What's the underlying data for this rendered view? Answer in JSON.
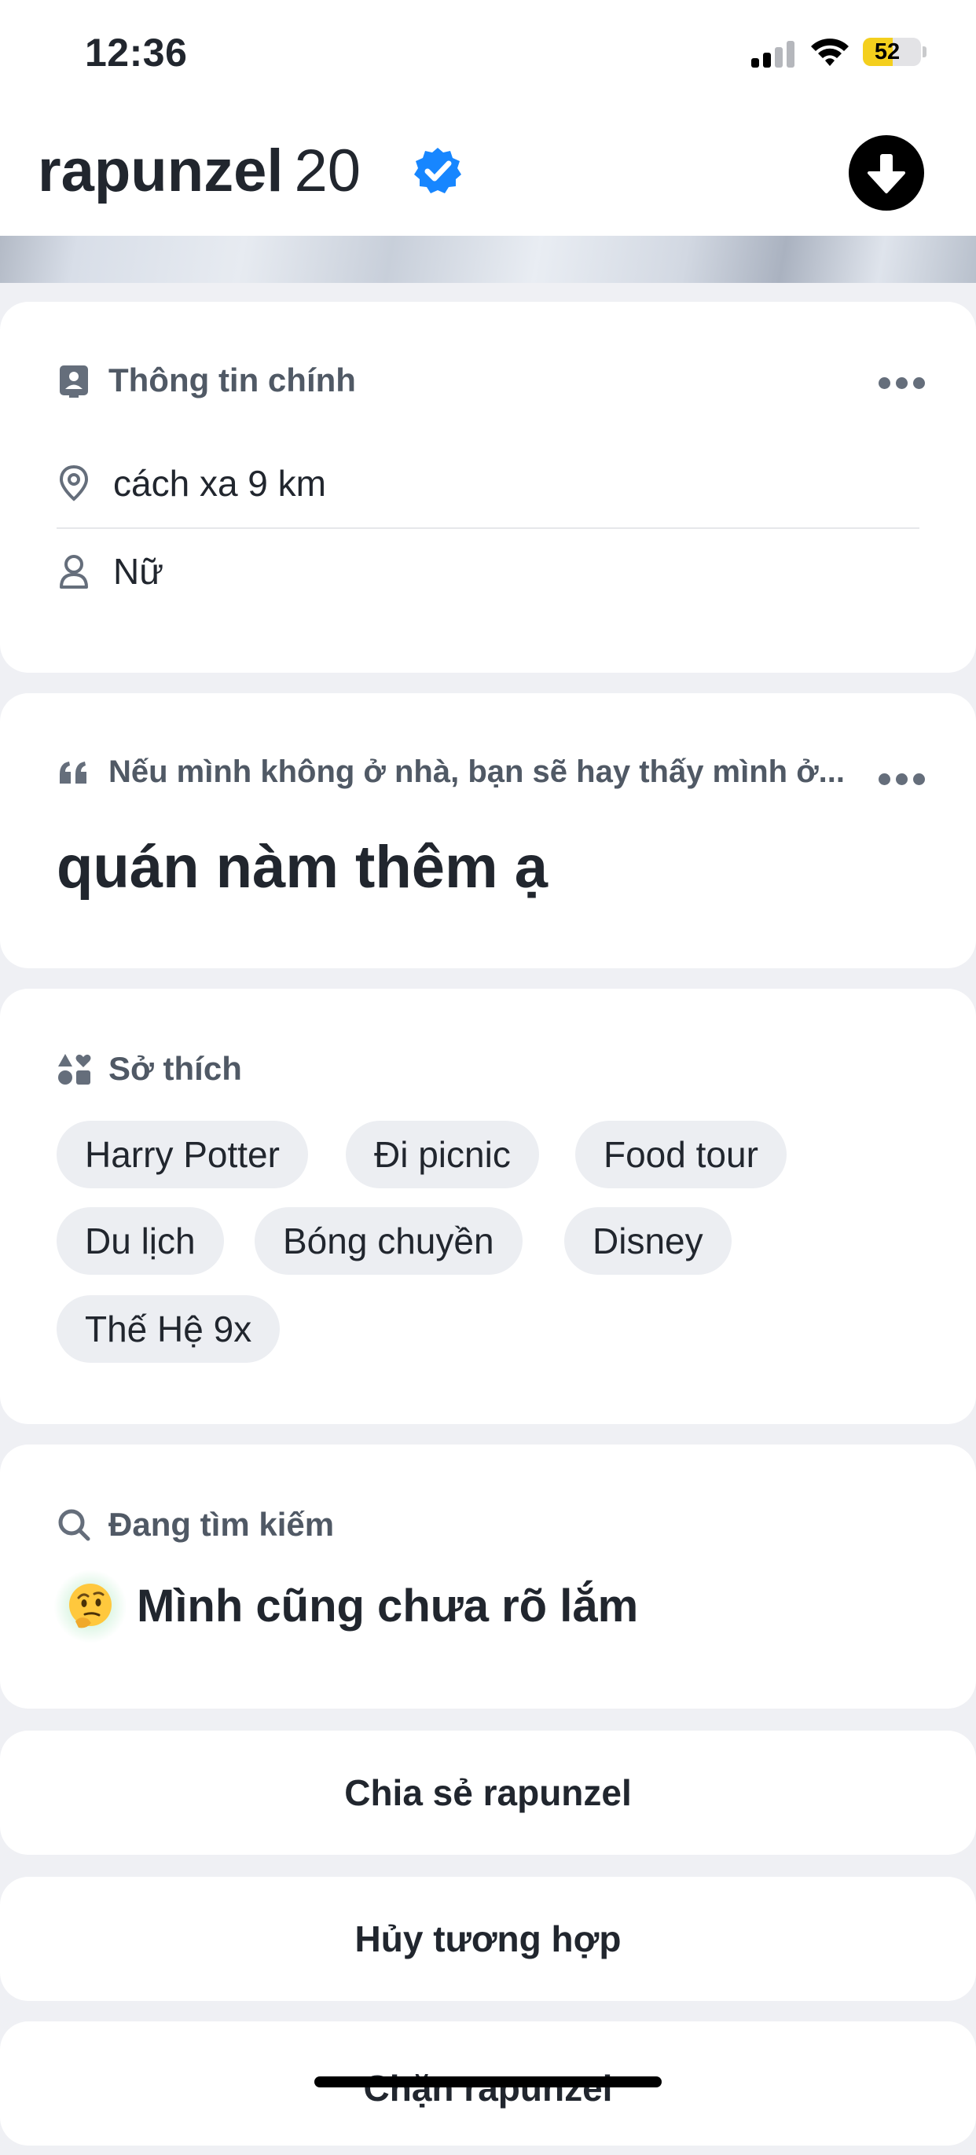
{
  "status_bar": {
    "time": "12:36",
    "battery_level": "52",
    "battery_percent": 52,
    "battery_color": "#f4cf1d"
  },
  "profile": {
    "name": "rapunzel",
    "age": "20",
    "verified": true,
    "verified_color": "#1786ff",
    "action_icon": "arrow-down-icon"
  },
  "basics": {
    "title": "Thông tin chính",
    "title_icon": "id-badge-icon",
    "distance": "cách xa 9 km",
    "gender": "Nữ"
  },
  "prompt": {
    "question": "Nếu mình không ở nhà, bạn sẽ hay thấy mình ở...",
    "answer": "quán nàm thêm ạ"
  },
  "interests": {
    "title": "Sở thích",
    "items": [
      "Harry Potter",
      "Đi picnic",
      "Food tour",
      "Du lịch",
      "Bóng chuyền",
      "Disney",
      "Thế Hệ 9x"
    ]
  },
  "looking_for": {
    "title": "Đang tìm kiếm",
    "emoji": "🤔",
    "value": "Mình cũng chưa rõ lắm"
  },
  "actions": {
    "share": "Chia sẻ rapunzel",
    "unmatch": "Hủy tương hợp",
    "block": "Chặn rapunzel"
  }
}
